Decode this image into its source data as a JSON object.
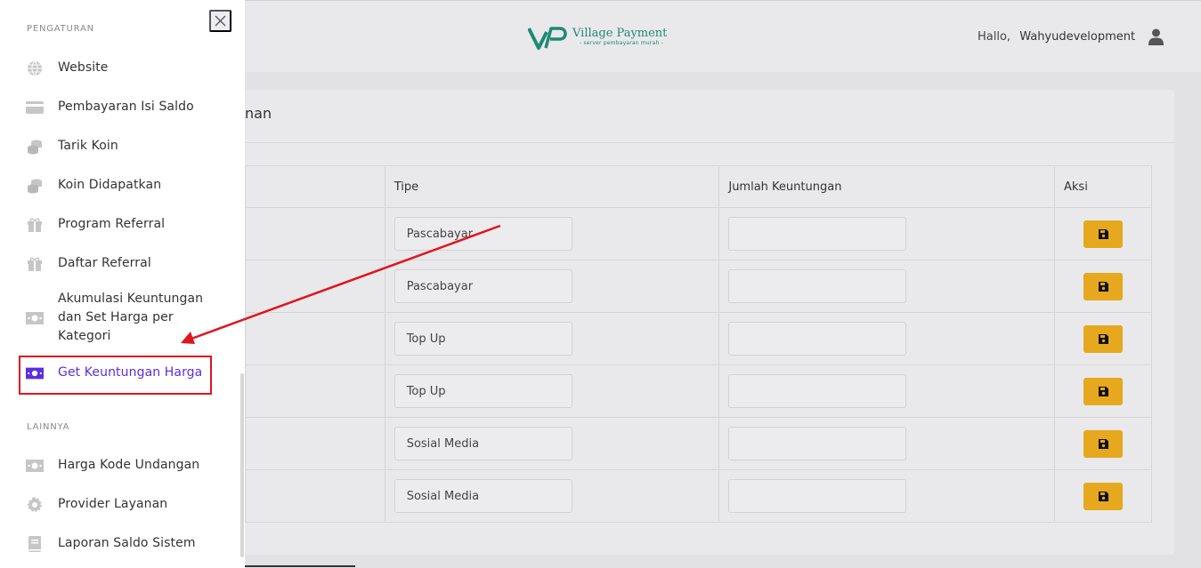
{
  "colors": {
    "accent": "#5b2ee0",
    "save_button": "#e5a81e",
    "highlight": "#e0161e",
    "brand": "#1e8a73"
  },
  "header": {
    "brand_name": "Village Payment",
    "brand_tagline": "- server pembayaran murah -",
    "greeting": "Hallo,",
    "username": "Wahyudevelopment"
  },
  "sidebar": {
    "section_pengaturan": "PENGATURAN",
    "section_lainnya": "LAINNYA",
    "items": [
      {
        "label": "Website",
        "icon": "globe-icon"
      },
      {
        "label": "Pembayaran Isi Saldo",
        "icon": "credit-card-icon"
      },
      {
        "label": "Tarik Koin",
        "icon": "coins-icon"
      },
      {
        "label": "Koin Didapatkan",
        "icon": "coins-icon"
      },
      {
        "label": "Program Referral",
        "icon": "gift-icon"
      },
      {
        "label": "Daftar Referral",
        "icon": "gift-icon"
      },
      {
        "label": "Akumulasi Keuntungan dan Set Harga per Kategori",
        "icon": "money-bill-icon"
      },
      {
        "label": "Get Keuntungan Harga",
        "icon": "money-bill-icon",
        "active": true
      },
      {
        "label": "Harga Kode Undangan",
        "icon": "money-bill-icon"
      },
      {
        "label": "Provider Layanan",
        "icon": "gear-icon"
      },
      {
        "label": "Laporan Saldo Sistem",
        "icon": "book-icon"
      }
    ]
  },
  "main": {
    "card_title_fragment": "nan",
    "table": {
      "headers": [
        "",
        "Tipe",
        "Jumlah Keuntungan",
        "Aksi"
      ],
      "rows": [
        {
          "tipe": "Pascabayar",
          "jumlah": ""
        },
        {
          "tipe": "Pascabayar",
          "jumlah": ""
        },
        {
          "tipe": "Top Up",
          "jumlah": ""
        },
        {
          "tipe": "Top Up",
          "jumlah": ""
        },
        {
          "tipe": "Sosial Media",
          "jumlah": ""
        },
        {
          "tipe": "Sosial Media",
          "jumlah": ""
        }
      ]
    }
  }
}
